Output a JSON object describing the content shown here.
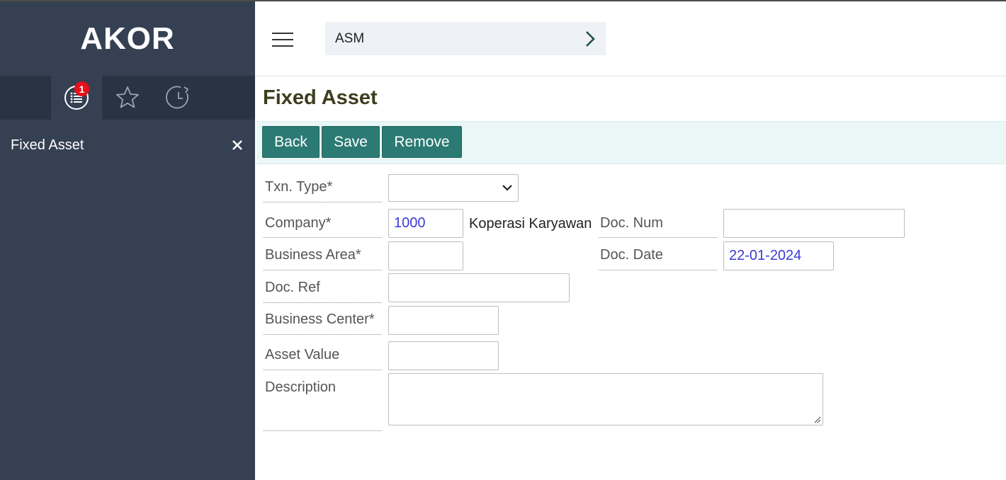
{
  "app": {
    "brand": "AKOR"
  },
  "sidebar": {
    "notification_count": "1",
    "open_item": {
      "label": "Fixed Asset"
    }
  },
  "header": {
    "breadcrumb": "ASM"
  },
  "page": {
    "title": "Fixed Asset"
  },
  "toolbar": {
    "back": "Back",
    "save": "Save",
    "remove": "Remove"
  },
  "form": {
    "txn_type": {
      "label": "Txn. Type*",
      "value": ""
    },
    "company": {
      "label": "Company*",
      "value": "1000",
      "name": "Koperasi Karyawan"
    },
    "doc_num": {
      "label": "Doc. Num",
      "value": ""
    },
    "business_area": {
      "label": "Business Area*",
      "value": ""
    },
    "doc_date": {
      "label": "Doc. Date",
      "value": "22-01-2024"
    },
    "doc_ref": {
      "label": "Doc. Ref",
      "value": ""
    },
    "business_center": {
      "label": "Business Center*",
      "value": ""
    },
    "asset_value": {
      "label": "Asset Value",
      "value": ""
    },
    "description": {
      "label": "Description",
      "value": ""
    }
  },
  "colors": {
    "sidebar": "#354052",
    "accent": "#2b7a74",
    "toolbar_bg": "#eaf7f6",
    "badge": "#e8101a"
  },
  "icons": [
    "list-icon",
    "star-icon",
    "history-icon",
    "close-icon",
    "menu-icon",
    "chevron-right-icon",
    "chevron-down-icon"
  ]
}
